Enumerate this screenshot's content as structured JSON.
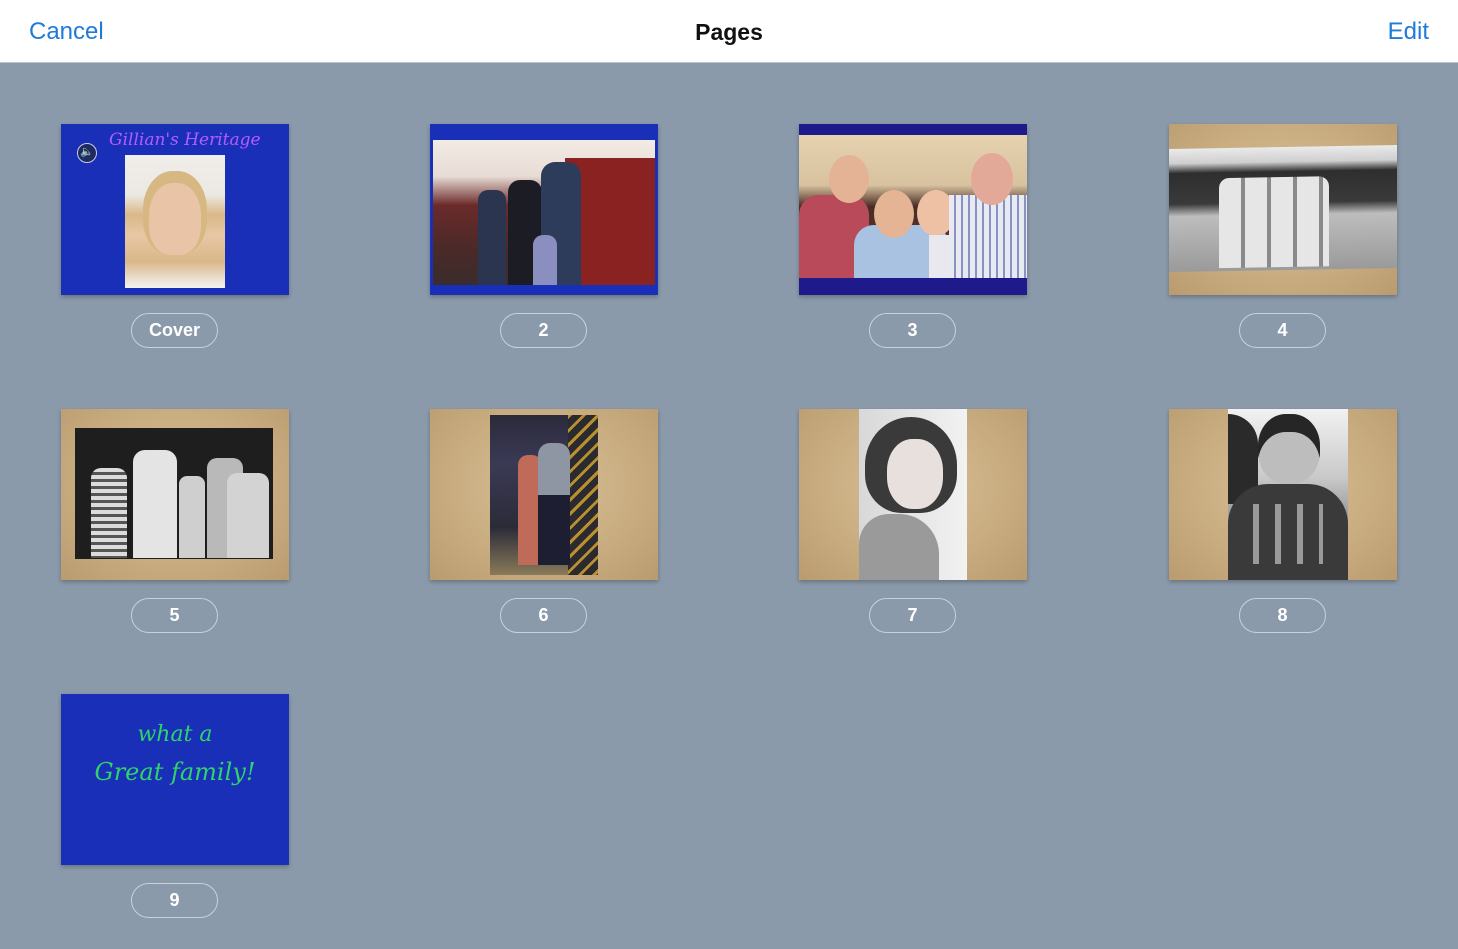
{
  "navbar": {
    "cancel_label": "Cancel",
    "title": "Pages",
    "edit_label": "Edit",
    "accent_color": "#1f7ad8"
  },
  "pages": [
    {
      "label": "Cover",
      "title_text": "Gillian's Heritage",
      "has_audio": true,
      "background": "blue",
      "thumbnail": "girl-portrait-photo"
    },
    {
      "label": "2",
      "background": "blue",
      "thumbnail": "family-outdoor-photo"
    },
    {
      "label": "3",
      "background": "blue",
      "thumbnail": "grandparents-with-kids-photo"
    },
    {
      "label": "4",
      "background": "paper",
      "thumbnail": "vintage-group-photo"
    },
    {
      "label": "5",
      "background": "paper",
      "thumbnail": "vintage-bench-family-photo"
    },
    {
      "label": "6",
      "background": "paper",
      "thumbnail": "couple-on-staircase-photo"
    },
    {
      "label": "7",
      "background": "paper",
      "thumbnail": "vintage-woman-portrait-photo"
    },
    {
      "label": "8",
      "background": "paper",
      "thumbnail": "vintage-pilot-portrait-photo"
    },
    {
      "label": "9",
      "background": "blue",
      "text_line1": "what a",
      "text_line2": "Great family!"
    }
  ],
  "colors": {
    "page_blue": "#1a2fb8",
    "title_purple": "#b45cff",
    "ending_green": "#2fd36a",
    "background": "#8a9aaa"
  }
}
